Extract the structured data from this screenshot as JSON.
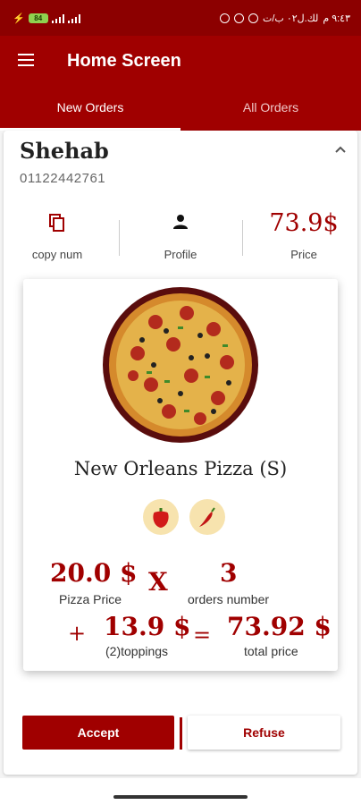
{
  "status_bar": {
    "time": "٩:٤٣ م",
    "carrier": "لك.ل٠٢ ب/ت",
    "battery": "84"
  },
  "app_bar": {
    "title": "Home Screen"
  },
  "tabs": [
    {
      "label": "New Orders",
      "active": true
    },
    {
      "label": "All Orders",
      "active": false
    }
  ],
  "order": {
    "customer_name": "Shehab",
    "phone": "01122442761",
    "actions": {
      "copy_label": "copy num",
      "profile_label": "Profile",
      "price_value": "73.9$",
      "price_label": "Price"
    },
    "pizza": {
      "name": "New Orleans Pizza (S)",
      "toppings_icons": [
        "red-pepper-icon",
        "chili-pepper-icon"
      ],
      "pizza_price_value": "20.0 $",
      "pizza_price_label": "Pizza Price",
      "multiply_symbol": "X",
      "orders_number_value": "3",
      "orders_number_label": "orders number",
      "plus_symbol": "+",
      "toppings_value": "13.9 $",
      "toppings_label": "(2)toppings",
      "equals_symbol": "=",
      "total_value": "73.92 $",
      "total_label": "total price"
    },
    "buttons": {
      "accept": "Accept",
      "refuse": "Refuse"
    }
  },
  "colors": {
    "primary": "#a00000",
    "status_bar": "#8c0000",
    "topping_bg": "#f7e3ae"
  }
}
